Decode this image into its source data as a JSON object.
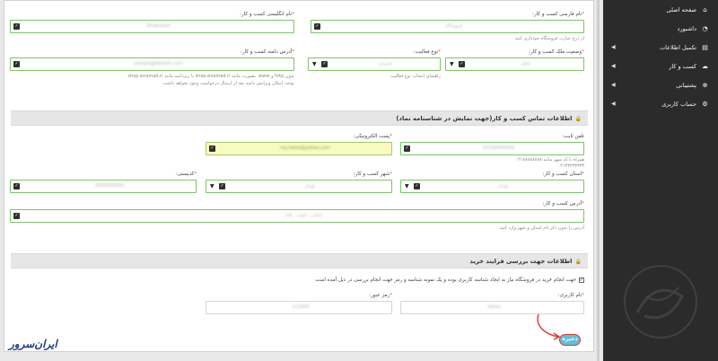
{
  "sidebar": {
    "items": [
      {
        "label": "صفحه اصلی",
        "icon": "home-icon",
        "glyph": "⌂",
        "has_chevron": false
      },
      {
        "label": "داشبورد",
        "icon": "dashboard-icon",
        "glyph": "◔",
        "has_chevron": false
      },
      {
        "label": "تکمیل اطلاعات",
        "icon": "file-icon",
        "glyph": "▤",
        "has_chevron": true
      },
      {
        "label": "کسب و کار",
        "icon": "cloud-icon",
        "glyph": "☁",
        "has_chevron": true
      },
      {
        "label": "پشتیبانی",
        "icon": "support-icon",
        "glyph": "⊕",
        "has_chevron": true
      },
      {
        "label": "حساب کاربری",
        "icon": "user-icon",
        "glyph": "⚙",
        "has_chevron": true
      }
    ]
  },
  "business": {
    "name_fa_label": "نام فارسی کسب و کار:",
    "name_fa_value": "فروشگاه",
    "name_fa_hint": "از درج عبارت فروشگاه خودداری کنید",
    "name_en_label": "نام انگلیسی کسب و کار:",
    "name_en_value": "Shopname",
    "ownership_label": "وضعیت ملک کسب و کار:",
    "ownership_value": "ملکی",
    "activity_label": "نوع فعالیت:",
    "activity_value": "اینترنتی",
    "activity_hint": "راهنمای انتخاب نوع فعالیت",
    "domain_label": "آدرس دامنه کسب و کار:",
    "domain_value": "sample@domain.com",
    "domain_hint_1": "بدون http و www. بصورت مانند shop.enamad.ir یا زیردامنه مانند shop.enamad.ir",
    "domain_hint_2": "توجه: امکان ویرایش دامنه بعد از ارسال درخواست وجود نخواهد داشت"
  },
  "contact": {
    "section_title": "اطلاعات تماس کسب و کار(جهت نمایش در شناسنامه نماد)",
    "phone_label": "تلفن ثابت:",
    "phone_value": "02100000000",
    "phone_hint_1": "همراه با کد شهر مانند ۰۲۱۸۸۸۸۸۸۸۸",
    "phone_hint_2": "۰۲۱۳۳۳۳۳۳۳۳",
    "email_label": "پست الکترونیکی:",
    "email_value": "my.name@yahoo.com",
    "province_label": "استان کسب و کار:",
    "province_value": "تهران",
    "city_label": "شهر کسب و کار:",
    "city_value": "تهران",
    "postal_label": "کدپستی:",
    "postal_value": "0000000000",
    "address_label": "آدرس کسب و کار:",
    "address_value": "خیابان - کوچه - پلاک",
    "address_hint": "آدرس را بدون ذکر نام استان و شهر وارد کنید"
  },
  "review": {
    "section_title": "اطلاعات جهت بررسی فرایند خرید",
    "checkbox_label": "جهت انجام خرید در فروشگاه نیاز به ایجاد شناسه کاربری بوده و یک نمونه شناسه و رمز جهت انجام بررسی در ذیل آمده است",
    "checkbox_checked": true,
    "username_label": "نام کاربری:",
    "username_value": "demo",
    "password_label": "رمز عبور:",
    "password_value": "123456"
  },
  "submit_label": "ذخیره",
  "brand": {
    "text": "ایران‌سرور"
  },
  "colors": {
    "accent": "#5bc0de",
    "valid_border": "#7cc36a",
    "highlight": "#f8fbbd",
    "sidebar": "#2b2b2b",
    "required": "#d9534f"
  }
}
